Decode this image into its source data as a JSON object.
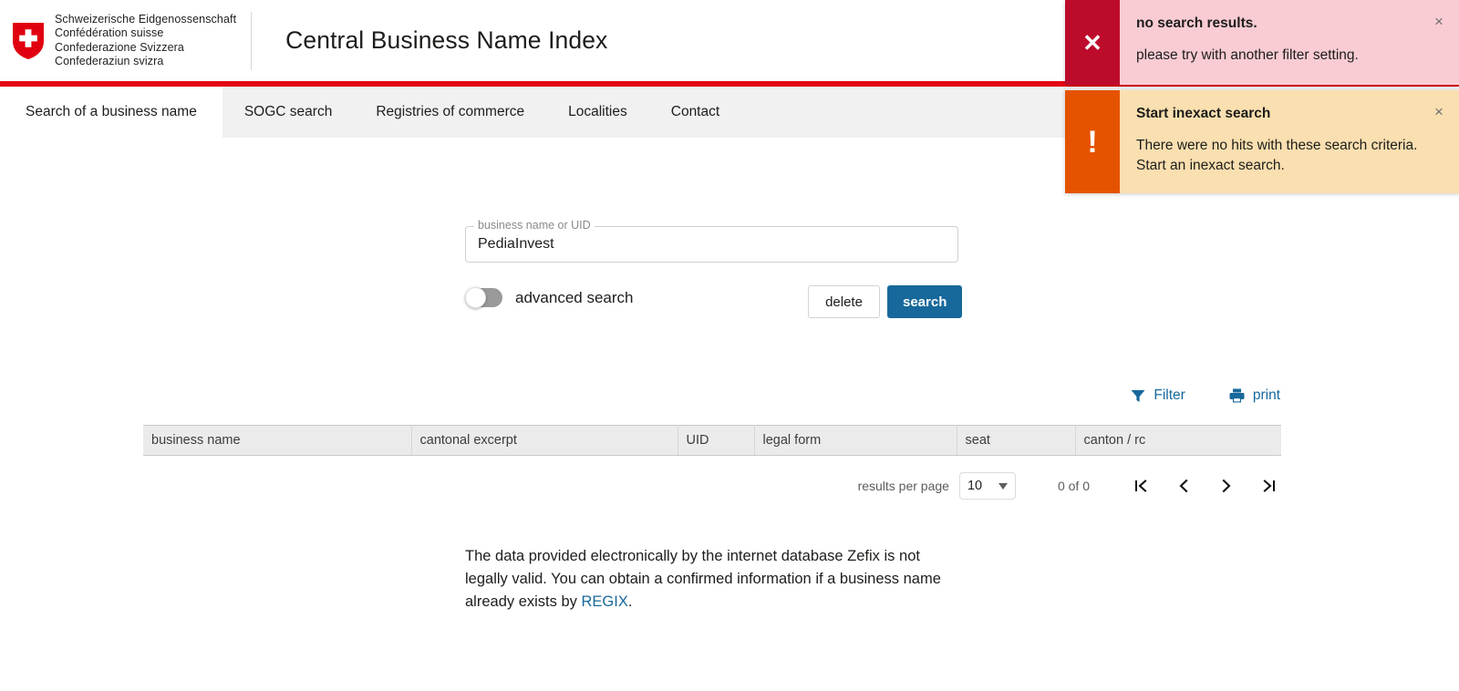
{
  "header": {
    "confederation_lines": [
      "Schweizerische Eidgenossenschaft",
      "Confédération suisse",
      "Confederazione Svizzera",
      "Confederaziun svizra"
    ],
    "app_title": "Central Business Name Index"
  },
  "tabs": [
    {
      "label": "Search of a business name",
      "active": true
    },
    {
      "label": "SOGC search",
      "active": false
    },
    {
      "label": "Registries of commerce",
      "active": false
    },
    {
      "label": "Localities",
      "active": false
    },
    {
      "label": "Contact",
      "active": false
    }
  ],
  "search": {
    "field_label": "business name or UID",
    "field_value": "PediaInvest",
    "field_placeholder": "",
    "advanced_label": "advanced search",
    "advanced_enabled": false,
    "delete_label": "delete",
    "search_label": "search"
  },
  "toolbar": {
    "filter_label": "Filter",
    "print_label": "print"
  },
  "table": {
    "columns": [
      "business name",
      "cantonal excerpt",
      "UID",
      "legal form",
      "seat",
      "canton / rc"
    ],
    "rows": []
  },
  "paginator": {
    "results_per_page_label": "results per page",
    "results_per_page_value": "10",
    "range_label": "0 of 0",
    "first_page_title": "first page",
    "prev_page_title": "previous page",
    "next_page_title": "next page",
    "last_page_title": "last page"
  },
  "disclaimer": {
    "text_before": "The data provided electronically by the internet database Zefix is not legally valid. You can obtain a confirmed information if a business name already exists by ",
    "link_label": "REGIX",
    "text_after": "."
  },
  "notifications": [
    {
      "kind": "error",
      "title": "no search results.",
      "message": "please try with another filter setting.",
      "icon": "close-x-icon",
      "close_label": "×",
      "accent": "#bd0b2c",
      "background": "#f9ccd4"
    },
    {
      "kind": "warning",
      "title": "Start inexact search",
      "message": "There were no hits with these search criteria. Start an inexact search.",
      "icon": "exclamation-icon",
      "close_label": "×",
      "accent": "#e65300",
      "background": "#fadfb0"
    }
  ],
  "colors": {
    "swiss_red": "#e30613",
    "link_blue": "#17689b",
    "primary_button": "#17689b",
    "tabbar_background": "#f1f1f1",
    "table_header_background": "#ebebeb"
  }
}
